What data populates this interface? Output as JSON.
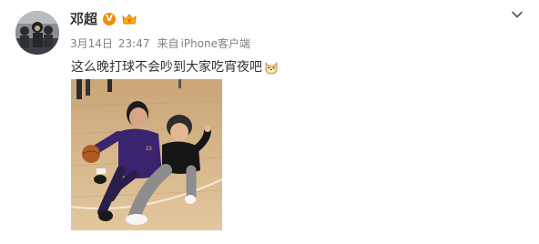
{
  "post": {
    "author": {
      "name": "邓超",
      "verified_badge": "V",
      "verified_badge_color": "#f28c0f",
      "member_badge_icon": "member-crown-icon"
    },
    "meta": {
      "date": "3月14日",
      "time": "23:47",
      "source_prefix": "来自",
      "source": "iPhone客户端"
    },
    "text": "这么晚打球不会吵到大家吃宵夜吧",
    "emoji_icon": "doge-emoji-icon",
    "collapse_icon": "chevron-down-icon",
    "photo_description_icon": "basketball-court-photo"
  }
}
